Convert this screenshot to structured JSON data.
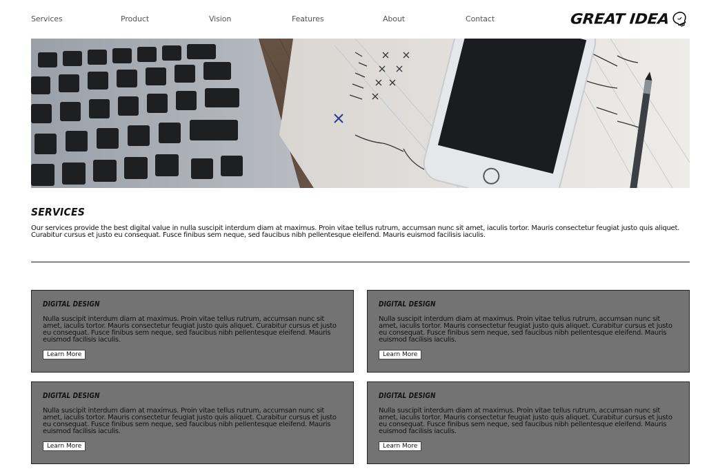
{
  "nav": {
    "links": [
      "Services",
      "Product",
      "Vision",
      "Features",
      "About",
      "Contact"
    ]
  },
  "logo": {
    "text": "GREAT IDEA",
    "icon": "lightbulb-icon"
  },
  "hero": {
    "image": "desk-with-keyboard-smartphone-notebook-pen"
  },
  "services": {
    "title": "Services",
    "description": "Our services provide the best digital value in nulla suscipit interdum diam at maximus. Proin vitae tellus rutrum, accumsan nunc sit amet, iaculis tortor. Mauris consectetur feugiat justo quis aliquet. Curabitur cursus et justo eu consequat. Fusce finibus sem neque, sed faucibus nibh pellentesque eleifend. Mauris euismod facilisis iaculis."
  },
  "cards": [
    {
      "title": "Digital Design",
      "text": "Nulla suscipit interdum diam at maximus. Proin vitae tellus rutrum, accumsan nunc sit amet, iaculis tortor. Mauris consectetur feugiat justo quis aliquet. Curabitur cursus et justo eu consequat. Fusce finibus sem neque, sed faucibus nibh pellentesque eleifend. Mauris euismod facilisis iaculis.",
      "button": "Learn More"
    },
    {
      "title": "Digital Design",
      "text": "Nulla suscipit interdum diam at maximus. Proin vitae tellus rutrum, accumsan nunc sit amet, iaculis tortor. Mauris consectetur feugiat justo quis aliquet. Curabitur cursus et justo eu consequat. Fusce finibus sem neque, sed faucibus nibh pellentesque eleifend. Mauris euismod facilisis iaculis.",
      "button": "Learn More"
    },
    {
      "title": "Digital Design",
      "text": "Nulla suscipit interdum diam at maximus. Proin vitae tellus rutrum, accumsan nunc sit amet, iaculis tortor. Mauris consectetur feugiat justo quis aliquet. Curabitur cursus et justo eu consequat. Fusce finibus sem neque, sed faucibus nibh pellentesque eleifend. Mauris euismod facilisis iaculis.",
      "button": "Learn More"
    },
    {
      "title": "Digital Design",
      "text": "Nulla suscipit interdum diam at maximus. Proin vitae tellus rutrum, accumsan nunc sit amet, iaculis tortor. Mauris consectetur feugiat justo quis aliquet. Curabitur cursus et justo eu consequat. Fusce finibus sem neque, sed faucibus nibh pellentesque eleifend. Mauris euismod facilisis iaculis.",
      "button": "Learn More"
    }
  ],
  "colors": {
    "card_bg": "#737373",
    "nav_text": "#555555",
    "text": "#111111"
  }
}
